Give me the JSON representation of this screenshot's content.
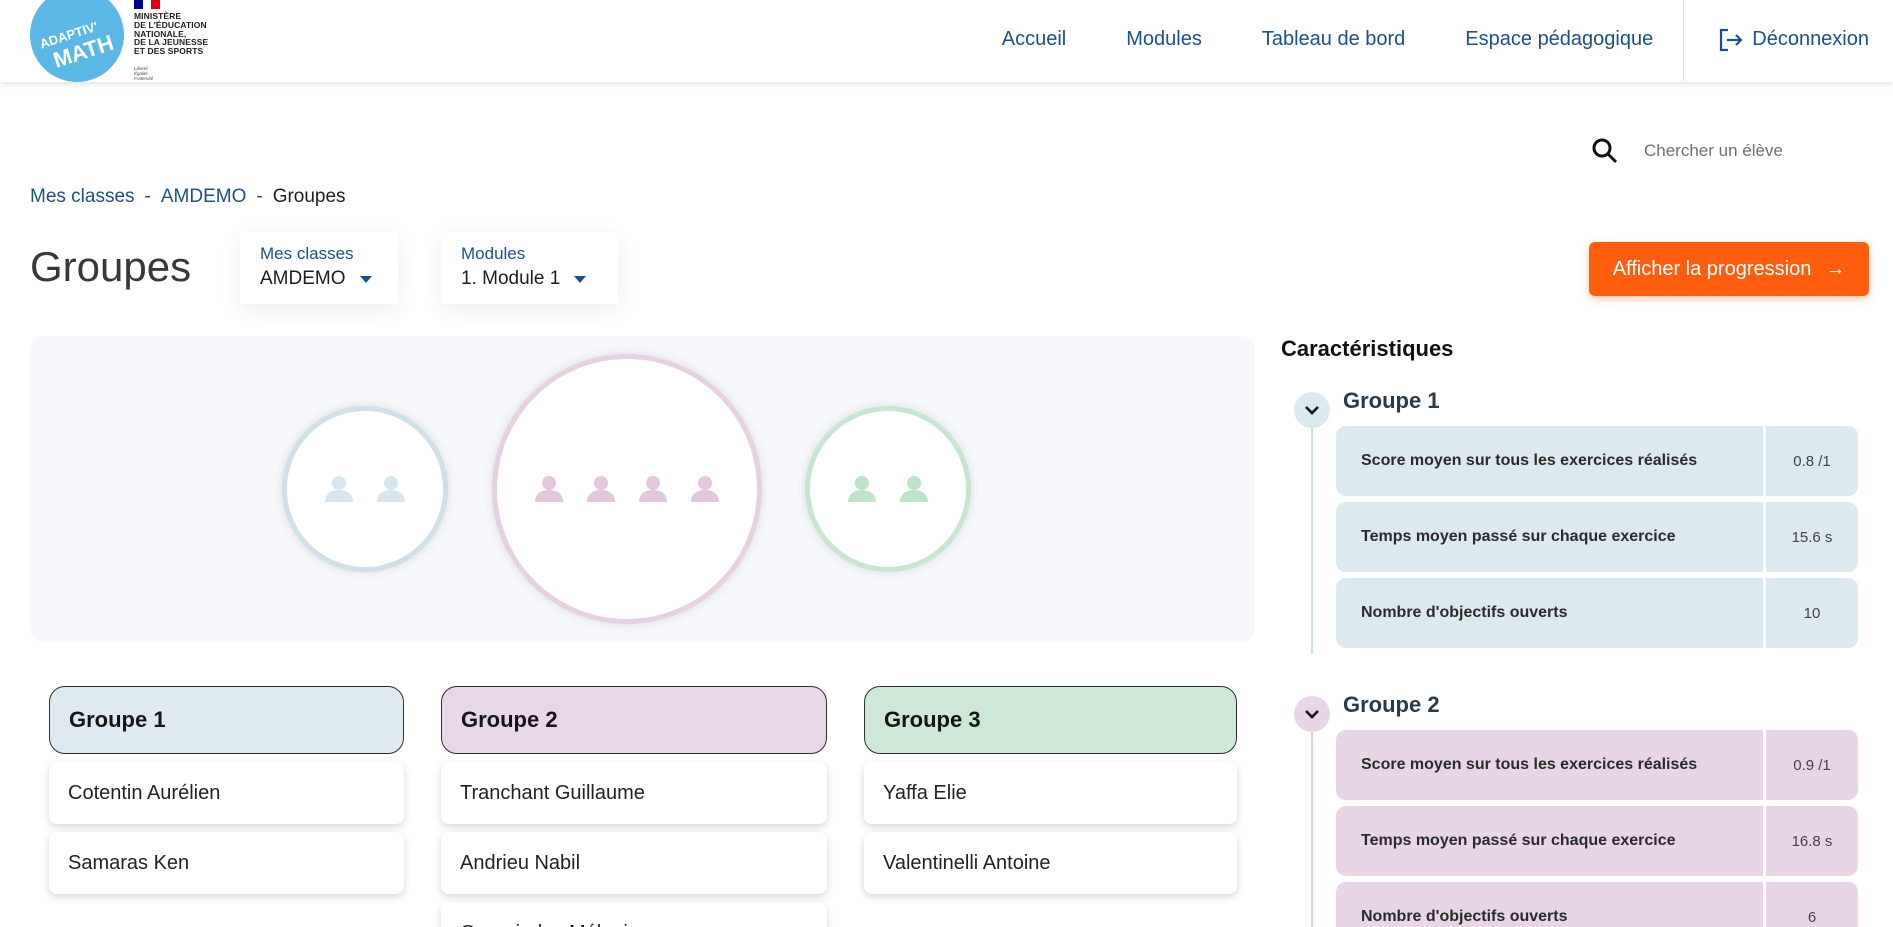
{
  "header": {
    "logo_text": [
      "ADAPTIV'",
      "MATH"
    ],
    "ministry_lines": [
      "MINISTÈRE",
      "DE L'ÉDUCATION",
      "NATIONALE,",
      "DE LA JEUNESSE",
      "ET DES SPORTS"
    ],
    "motto_lines": [
      "Liberté",
      "Égalité",
      "Fraternité"
    ],
    "nav": [
      "Accueil",
      "Modules",
      "Tableau de bord",
      "Espace pédagogique"
    ],
    "logout_label": "Déconnexion"
  },
  "search": {
    "placeholder": "Chercher un élève"
  },
  "breadcrumb": {
    "items": [
      "Mes classes",
      "AMDEMO"
    ],
    "current": "Groupes",
    "separator": "-"
  },
  "page_title": "Groupes",
  "filters": {
    "classes": {
      "label": "Mes classes",
      "value": "AMDEMO"
    },
    "modules": {
      "label": "Modules",
      "value": "1. Module 1"
    }
  },
  "cta_label": "Afficher la progression",
  "bubbles": [
    {
      "group": "Groupe 1",
      "students": 2,
      "color": "#cfe0e8",
      "person_color": "#d6e6ec"
    },
    {
      "group": "Groupe 2",
      "students": 4,
      "color": "#e6d1e1",
      "person_color": "#e3c8dc"
    },
    {
      "group": "Groupe 3",
      "students": 2,
      "color": "#c7e6d2",
      "person_color": "#bfe3cc"
    }
  ],
  "groups": [
    {
      "name": "Groupe 1",
      "color": "#dfeaf0",
      "students": [
        "Cotentin Aurélien",
        "Samaras Ken"
      ]
    },
    {
      "name": "Groupe 2",
      "color": "#e8d7e6",
      "students": [
        "Tranchant Guillaume",
        "Andrieu Nabil",
        "Georgiades Mélanie"
      ]
    },
    {
      "name": "Groupe 3",
      "color": "#cde8d6",
      "students": [
        "Yaffa Elie",
        "Valentinelli Antoine"
      ]
    }
  ],
  "characteristics": {
    "title": "Caractéristiques",
    "groups": [
      {
        "name": "Groupe 1",
        "color": "#dce9ef",
        "line_color": "#c9e6d6",
        "rows": [
          {
            "label": "Score moyen sur tous les exercices réalisés",
            "value": "0.8 /1"
          },
          {
            "label": "Temps moyen passé sur chaque exercice",
            "value": "15.6 s"
          },
          {
            "label": "Nombre d'objectifs ouverts",
            "value": "10"
          }
        ]
      },
      {
        "name": "Groupe 2",
        "color": "#e8d6e6",
        "line_color": "#e3cfe0",
        "rows": [
          {
            "label": "Score moyen sur tous les exercices réalisés",
            "value": "0.9 /1"
          },
          {
            "label": "Temps moyen passé sur chaque exercice",
            "value": "16.8 s"
          },
          {
            "label": "Nombre d'objectifs ouverts",
            "value": "6"
          }
        ]
      }
    ]
  }
}
